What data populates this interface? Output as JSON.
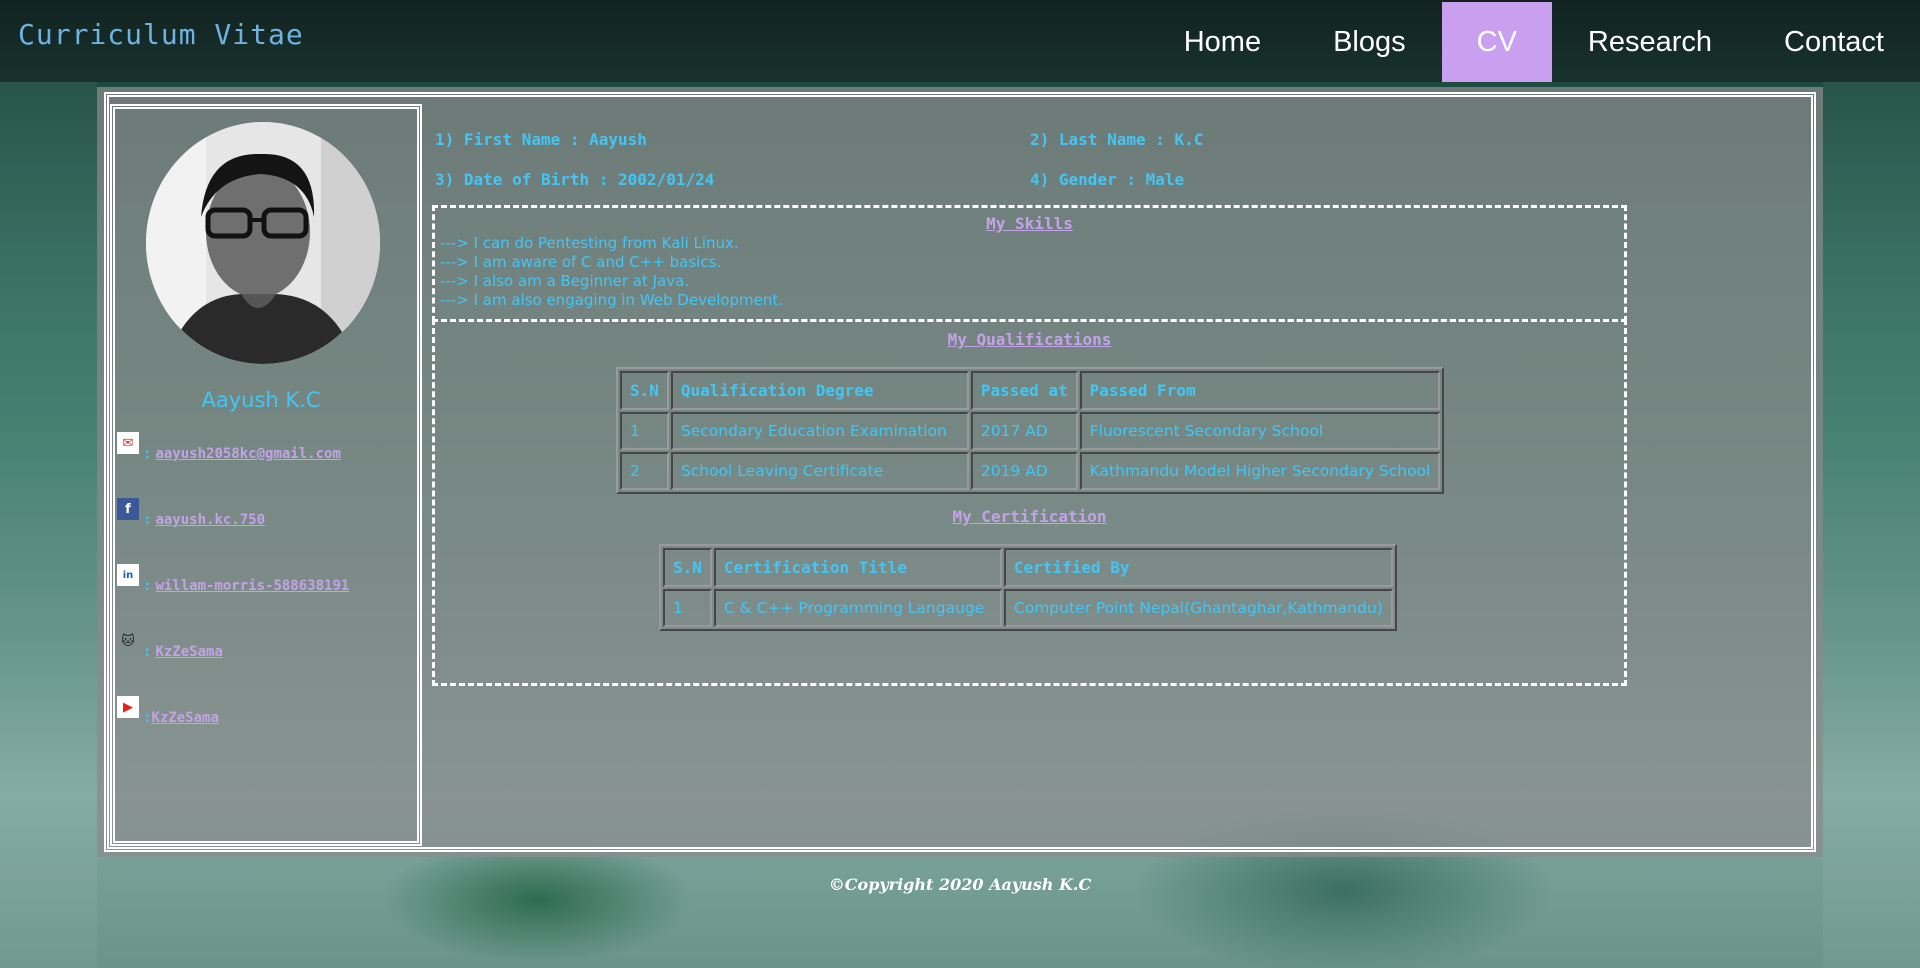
{
  "site": {
    "title": "Curriculum Vitae"
  },
  "nav": {
    "items": [
      {
        "label": "Home"
      },
      {
        "label": "Blogs"
      },
      {
        "label": "CV",
        "active": true
      },
      {
        "label": "Research"
      },
      {
        "label": "Contact"
      }
    ]
  },
  "profile": {
    "name": "Aayush K.C",
    "contacts": [
      {
        "icon": "gmail-icon",
        "prefix": ":",
        "text": "aayush2058kc@gmail.com"
      },
      {
        "icon": "facebook-icon",
        "prefix": ":",
        "text": "aayush.kc.750"
      },
      {
        "icon": "linkedin-icon",
        "prefix": ":",
        "text": "willam-morris-588638191"
      },
      {
        "icon": "github-icon",
        "prefix": ":",
        "text": "KzZeSama"
      },
      {
        "icon": "youtube-icon",
        "prefix": ":",
        "text": "KzZeSama"
      }
    ]
  },
  "info": {
    "first_name": "1) First Name : Aayush",
    "last_name": "2) Last Name : K.C",
    "dob": "3) Date of Birth : 2002/01/24",
    "gender": "4) Gender : Male"
  },
  "skills": {
    "heading": "My Skills",
    "items": [
      "---> I can do Pentesting from Kali Linux.",
      "---> I am aware of C and C++ basics.",
      "---> I also am a Beginner at Java.",
      "---> I am also engaging in Web Development."
    ]
  },
  "qualifications": {
    "heading": "My Qualifications",
    "headers": [
      "S.N",
      "Qualification Degree",
      "Passed at",
      "Passed From"
    ],
    "rows": [
      [
        "1",
        "Secondary Education Examination",
        "2017 AD",
        "Fluorescent Secondary School"
      ],
      [
        "2",
        "School Leaving Certificate",
        "2019 AD",
        "Kathmandu Model Higher Secondary School"
      ]
    ]
  },
  "certification": {
    "heading": "My Certification",
    "headers": [
      "S.N",
      "Certification Title",
      "Certified By"
    ],
    "rows": [
      [
        "1",
        "C & C++ Programming Langauge",
        "Computer Point Nepal(Ghantaghar,Kathmandu)"
      ]
    ]
  },
  "footer": {
    "text": "©Copyright 2020 Aayush K.C"
  },
  "colors": {
    "accent_blue": "#42c6f5",
    "link_purple": "#c3a3e8",
    "nav_active": "#c9a0f0"
  }
}
